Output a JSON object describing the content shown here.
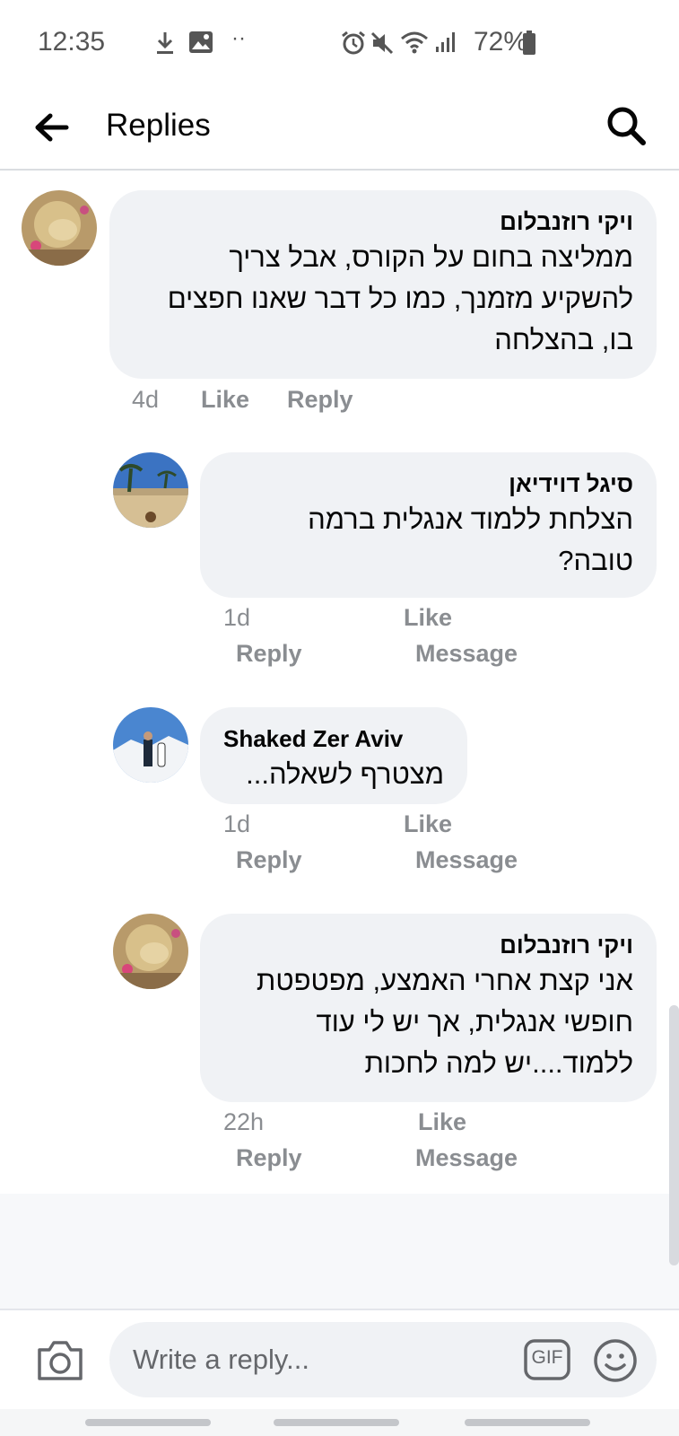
{
  "status_bar": {
    "time": "12:35",
    "battery": "72%",
    "icons": [
      "download-icon",
      "image-icon",
      "more-dots-icon",
      "alarm-icon",
      "mute-icon",
      "wifi-icon",
      "signal-icon",
      "battery-icon"
    ]
  },
  "header": {
    "title": "Replies",
    "back_icon": "back-arrow-icon",
    "search_icon": "search-icon"
  },
  "comments": [
    {
      "author": "ויקי רוזנבלום",
      "lines": [
        "ממליצה בחום על הקורס, אבל צריך",
        "להשקיע מזמנך, כמו כל דבר שאנו חפצים",
        "בו, בהצלחה"
      ],
      "time": "4d",
      "like": "Like",
      "reply": "Reply"
    },
    {
      "author": "סיגל דוידיאן",
      "lines": [
        "הצלחת ללמוד אנגלית ברמה",
        "טובה?"
      ],
      "time": "1d",
      "like": "Like",
      "reply": "Reply",
      "message": "Message"
    },
    {
      "author": "Shaked Zer Aviv",
      "lines": [
        "מצטרף לשאלה..."
      ],
      "time": "1d",
      "like": "Like",
      "reply": "Reply",
      "message": "Message"
    },
    {
      "author": "ויקי רוזנבלום",
      "lines": [
        "אני קצת אחרי האמצע, מפטפטת",
        "חופשי אנגלית, אך יש לי עוד",
        "ללמוד....יש למה לחכות"
      ],
      "time": "22h",
      "like": "Like",
      "reply": "Reply",
      "message": "Message"
    }
  ],
  "composer": {
    "placeholder": "Write a reply...",
    "gif_label": "GIF",
    "camera_icon": "camera-icon",
    "emoji_icon": "emoji-icon"
  }
}
